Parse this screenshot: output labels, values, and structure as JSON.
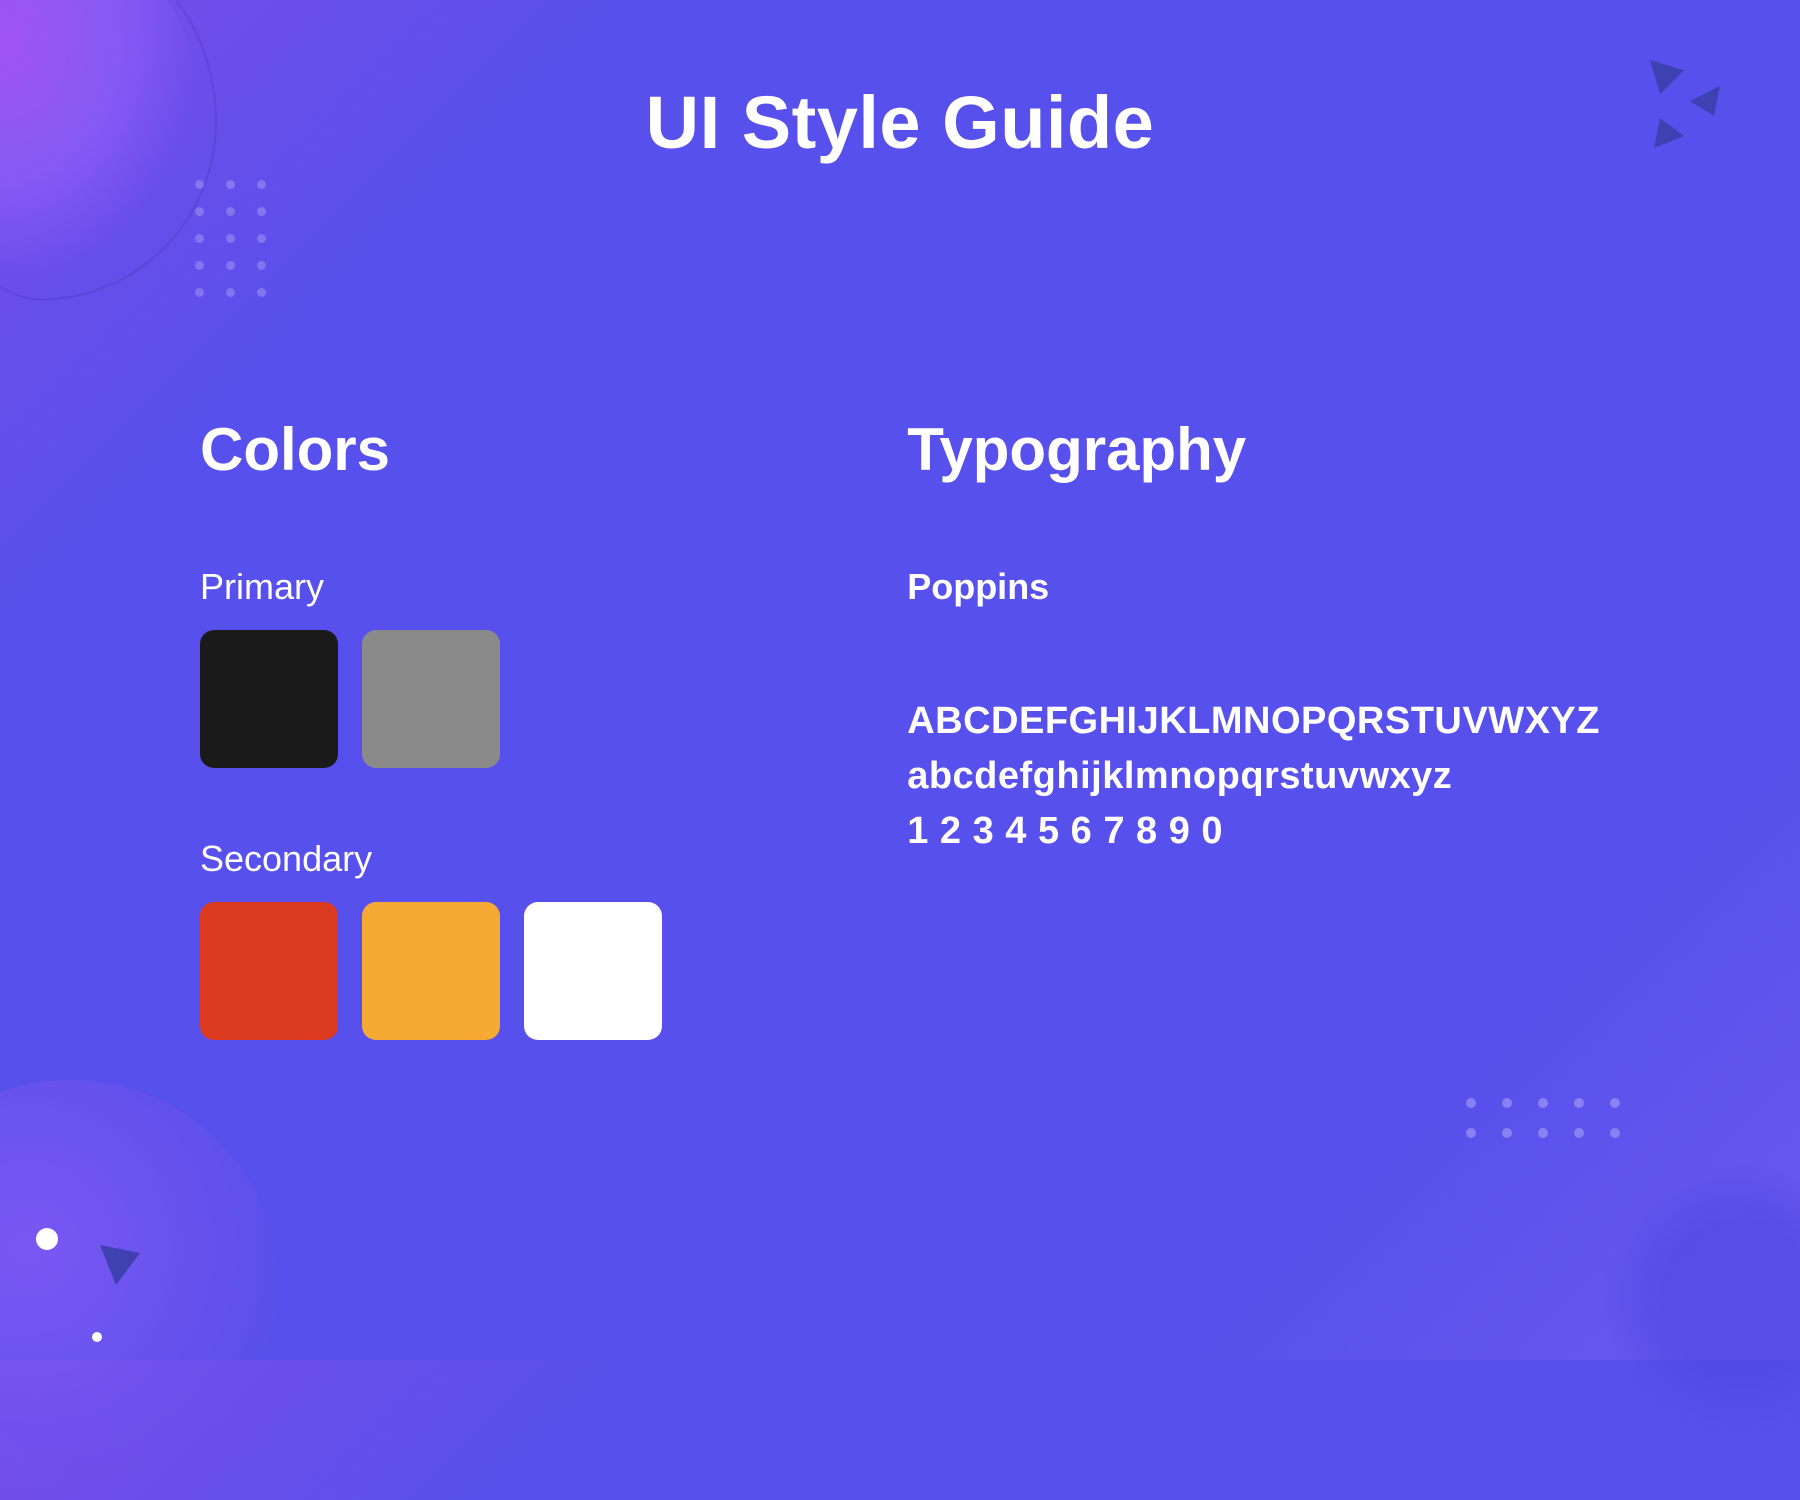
{
  "title": "UI Style Guide",
  "colors": {
    "heading": "Colors",
    "primary": {
      "label": "Primary",
      "swatches": [
        "#1a1a1a",
        "#8a8a8a"
      ]
    },
    "secondary": {
      "label": "Secondary",
      "swatches": [
        "#dd3b20",
        "#f7aa33",
        "#ffffff"
      ]
    }
  },
  "typography": {
    "heading": "Typography",
    "font_name": "Poppins",
    "sample_upper": "ABCDEFGHIJKLMNOPQRSTUVWXYZ",
    "sample_lower": "abcdefghijklmnopqrstuvwxyz",
    "sample_digits": "1 2 3 4 5 6 7 8 9 0"
  }
}
